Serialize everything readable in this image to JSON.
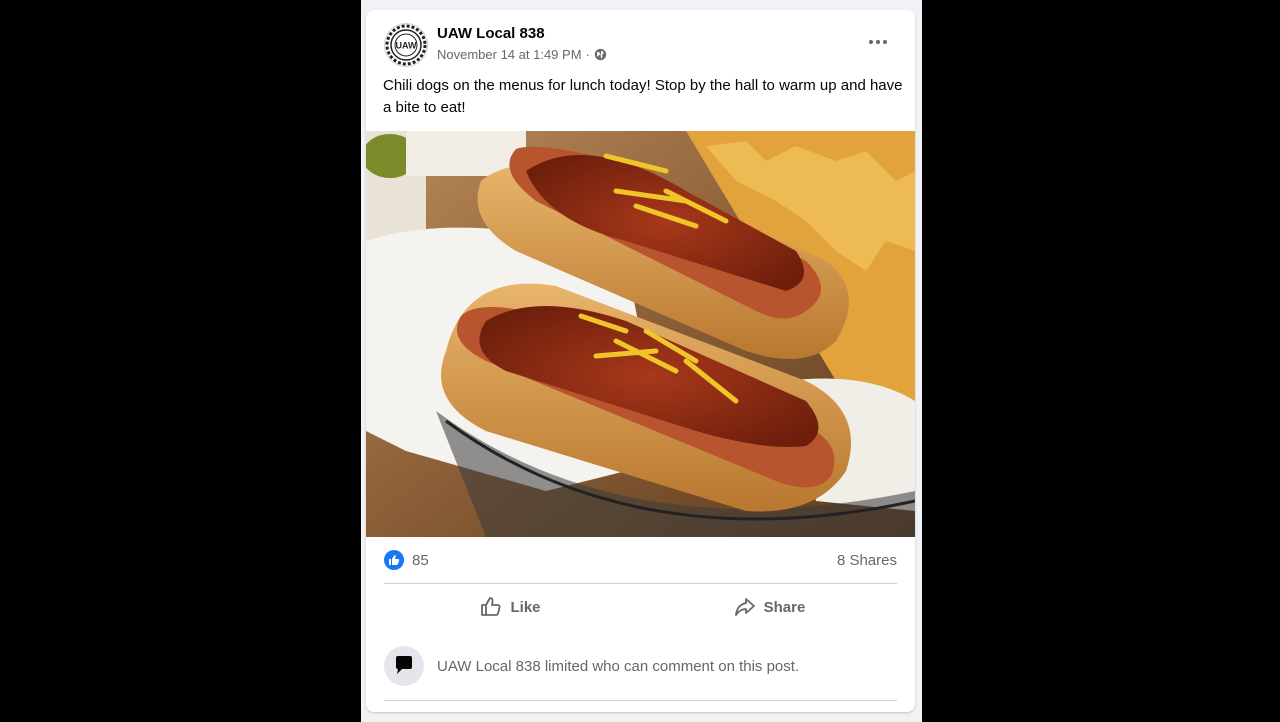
{
  "post": {
    "page_name": "UAW Local 838",
    "avatar_text": "UAW",
    "timestamp": "November 14 at 1:49 PM",
    "separator": "·",
    "privacy_icon": "globe-icon",
    "text": "Chili dogs on the menus for lunch today! Stop by the hall to warm up and have a bite to eat!",
    "image_subject": "photo-chili-dogs-basket"
  },
  "stats": {
    "reaction_icon": "like-reaction-icon",
    "reactions": "85",
    "shares": "8 Shares"
  },
  "actions": [
    {
      "label": "Like",
      "icon": "thumbs-up-icon"
    },
    {
      "label": "Share",
      "icon": "share-arrow-icon"
    }
  ],
  "comment_notice": {
    "icon": "speech-bubble-icon",
    "text": "UAW Local 838 limited who can comment on this post."
  },
  "colors": {
    "background": "#000000",
    "feed": "#f0f2f5",
    "card": "#ffffff",
    "like_blue": "#1877f2",
    "secondary_text": "#65676b"
  }
}
